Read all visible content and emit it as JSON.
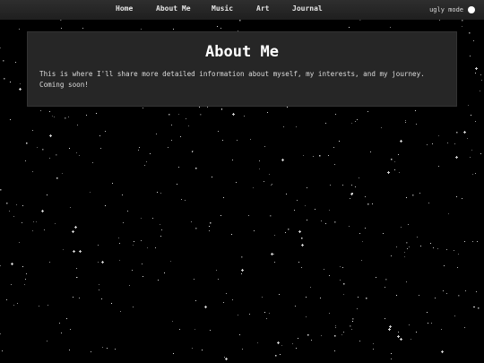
{
  "nav": {
    "links": [
      {
        "label": "Home"
      },
      {
        "label": "About Me"
      },
      {
        "label": "Music"
      },
      {
        "label": "Art"
      },
      {
        "label": "Journal"
      }
    ],
    "toggle_label": "ugly mode"
  },
  "main": {
    "title": "About Me",
    "text": "This is where I'll share more detailed information about myself, my interests, and my journey. Coming soon!"
  },
  "colors": {
    "background": "#000000",
    "navbar": "#2a2a2a",
    "panel": "#262626",
    "text": "#dcdcdc"
  }
}
